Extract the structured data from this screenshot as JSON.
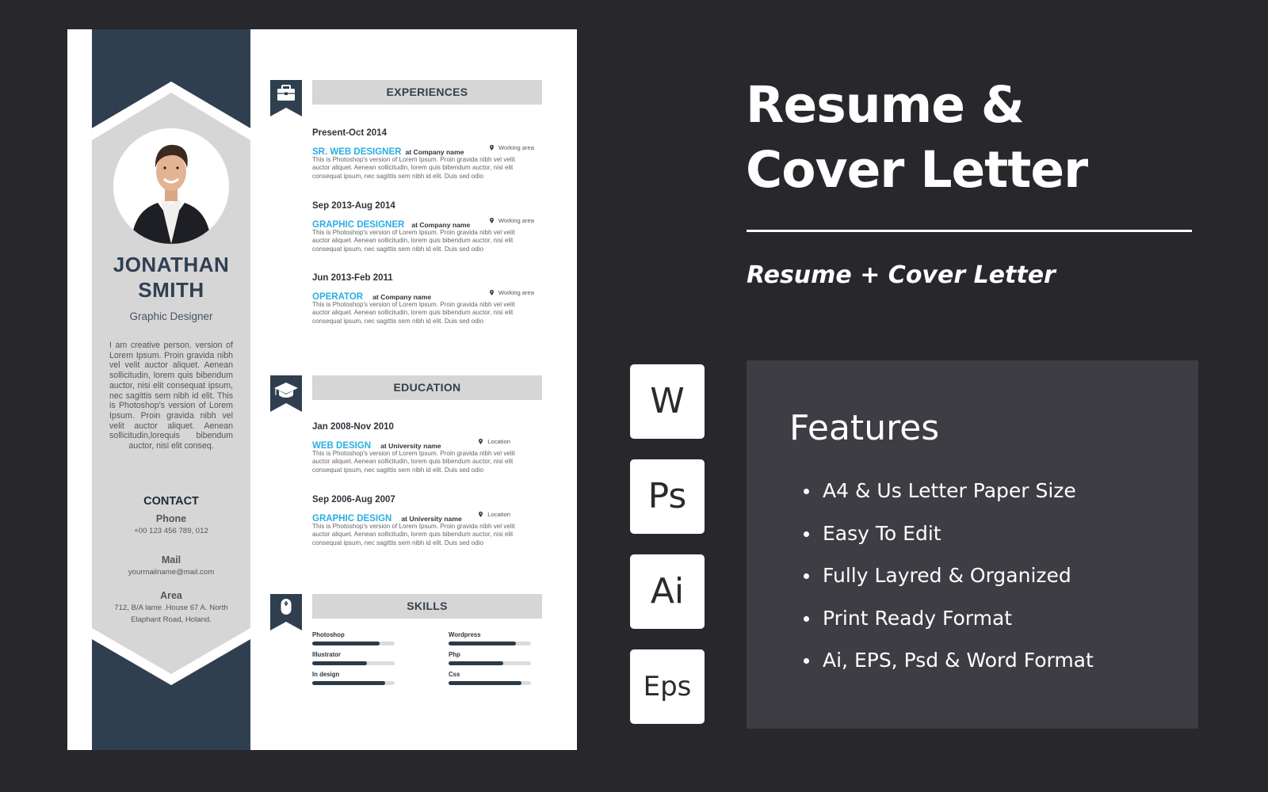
{
  "resume": {
    "name_line1": "JONATHAN",
    "name_line2": "SMITH",
    "role": "Graphic Designer",
    "about": "I am creative person. version of Lorem Ipsum. Proin gravida nibh vel velit auctor aliquet. Aenean sollicitudin, lorem quis bibendum auctor, nisi elit consequat ipsum, nec sagittis sem nibh id elit. This is Photoshop's version of Lorem Ipsum. Proin gravida nibh vel velit auctor aliquet. Aenean sollicitudin,lorequis bibendum auctor, nisi elit conseq.",
    "contact": {
      "title": "CONTACT",
      "phone_label": "Phone",
      "phone": "+00 123 456 789, 012",
      "mail_label": "Mail",
      "mail": "yourmailname@mail.com",
      "area_label": "Area",
      "area_line1": "712, B/A lame .House 67 A. North",
      "area_line2": "Elaphant Road, Holand."
    },
    "colors": {
      "sidebar_dark": "#2f3f4f",
      "sidebar_light": "#d6d6d6",
      "accent": "#2aaee3",
      "section_head_bg": "#d6d6d6"
    },
    "sections": {
      "experiences": {
        "title": "EXPERIENCES",
        "icon": "briefcase-icon",
        "items": [
          {
            "date": "Present-Oct 2014",
            "title": "SR. WEB DESIGNER",
            "org": "at Company name",
            "location": "Working area",
            "desc": "This is Photoshop's version of Lorem Ipsum. Proin gravida nibh vel velit auctor aliquet. Aenean sollicitudin, lorem quis bibendum auctor, nisi elit consequat ipsum, nec sagittis sem nibh id elit. Duis sed odio"
          },
          {
            "date": "Sep 2013-Aug 2014",
            "title": "GRAPHIC DESIGNER",
            "org": "at Company name",
            "location": "Working area",
            "desc": "This is Photoshop's version of Lorem Ipsum. Proin gravida nibh vel velit auctor aliquet. Aenean sollicitudin, lorem quis bibendum auctor, nisi elit consequat ipsum, nec sagittis sem nibh id elit. Duis sed odio"
          },
          {
            "date": "Jun 2013-Feb 2011",
            "title": "OPERATOR",
            "org": "at Company name",
            "location": "Working area",
            "desc": "This is Photoshop's version of Lorem Ipsum. Proin gravida nibh vel velit auctor aliquet. Aenean sollicitudin, lorem quis bibendum auctor, nisi elit consequat ipsum, nec sagittis sem nibh id elit. Duis sed odio"
          }
        ]
      },
      "education": {
        "title": "EDUCATION",
        "icon": "graduation-cap-icon",
        "items": [
          {
            "date": "Jan 2008-Nov 2010",
            "title": "WEB DESIGN",
            "org": "at University name",
            "location": "Location",
            "desc": "This is Photoshop's version of Lorem Ipsum. Proin gravida nibh vel velit auctor aliquet. Aenean sollicitudin, lorem quis bibendum auctor, nisi elit consequat ipsum, nec sagittis sem nibh id elit. Duis sed odio"
          },
          {
            "date": "Sep 2006-Aug 2007",
            "title": "GRAPHIC DESIGN",
            "org": "at University name",
            "location": "Location",
            "desc": "This is Photoshop's version of Lorem Ipsum. Proin gravida nibh vel velit auctor aliquet. Aenean sollicitudin, lorem quis bibendum auctor, nisi elit consequat ipsum, nec sagittis sem nibh id elit. Duis sed odio"
          }
        ]
      },
      "skills": {
        "title": "SKILLS",
        "icon": "mouse-icon",
        "items": [
          {
            "label": "Photoshop",
            "level": 0.82
          },
          {
            "label": "Wordpress",
            "level": 0.82
          },
          {
            "label": "Illustrator",
            "level": 0.66
          },
          {
            "label": "Php",
            "level": 0.66
          },
          {
            "label": "In design",
            "level": 0.88
          },
          {
            "label": "Css",
            "level": 0.88
          }
        ]
      }
    }
  },
  "promo": {
    "headline_line1": "Resume &",
    "headline_line2": "Cover Letter",
    "subtitle": "Resume + Cover Letter",
    "formats": [
      "W",
      "Ps",
      "Ai",
      "Eps"
    ],
    "features_title": "Features",
    "features": [
      "A4 & Us Letter Paper Size",
      "Easy To Edit",
      "Fully Layred & Organized",
      "Print Ready Format",
      "Ai, EPS, Psd & Word Format"
    ],
    "colors": {
      "background": "#28272c",
      "features_panel": "#3e3d43",
      "text": "#ffffff"
    }
  }
}
